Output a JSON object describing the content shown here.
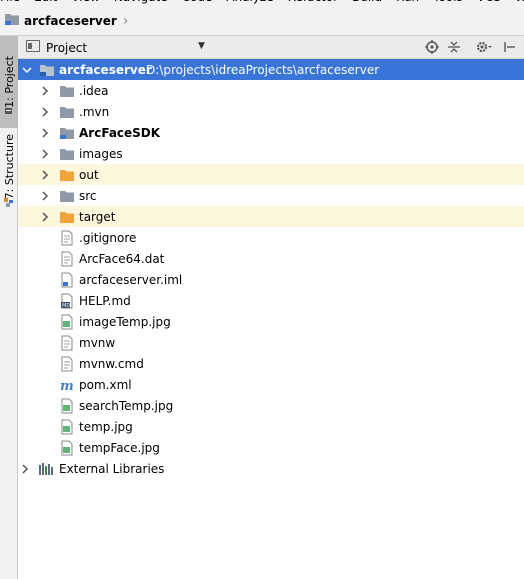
{
  "menu": [
    "File",
    "Edit",
    "View",
    "Navigate",
    "Code",
    "Analyze",
    "Refactor",
    "Build",
    "Run",
    "Tools",
    "VCS",
    "Window"
  ],
  "breadcrumb": {
    "project": "arcfaceserver"
  },
  "left_strip": {
    "project_tab": "1: Project",
    "structure_tab": "7: Structure"
  },
  "panel": {
    "title": "Project"
  },
  "tree": {
    "root": {
      "name": "arcfaceserver",
      "path": "D:\\projects\\idreaProjects\\arcfaceserver"
    },
    "items": [
      {
        "label": ".idea",
        "type": "folder"
      },
      {
        "label": ".mvn",
        "type": "folder"
      },
      {
        "label": "ArcFaceSDK",
        "type": "module-folder"
      },
      {
        "label": "images",
        "type": "folder"
      },
      {
        "label": "out",
        "type": "excluded-folder"
      },
      {
        "label": "src",
        "type": "folder"
      },
      {
        "label": "target",
        "type": "excluded-folder"
      },
      {
        "label": ".gitignore",
        "type": "file"
      },
      {
        "label": "ArcFace64.dat",
        "type": "file"
      },
      {
        "label": "arcfaceserver.iml",
        "type": "iml"
      },
      {
        "label": "HELP.md",
        "type": "md"
      },
      {
        "label": "imageTemp.jpg",
        "type": "image"
      },
      {
        "label": "mvnw",
        "type": "file"
      },
      {
        "label": "mvnw.cmd",
        "type": "file"
      },
      {
        "label": "pom.xml",
        "type": "maven"
      },
      {
        "label": "searchTemp.jpg",
        "type": "image"
      },
      {
        "label": "temp.jpg",
        "type": "image"
      },
      {
        "label": "tempFace.jpg",
        "type": "image"
      }
    ],
    "external": "External Libraries"
  },
  "colors": {
    "selection": "#3875d7",
    "excluded_bg": "#fdf7dd",
    "excluded_folder": "#f0a43a",
    "folder": "#8f9aa6"
  }
}
